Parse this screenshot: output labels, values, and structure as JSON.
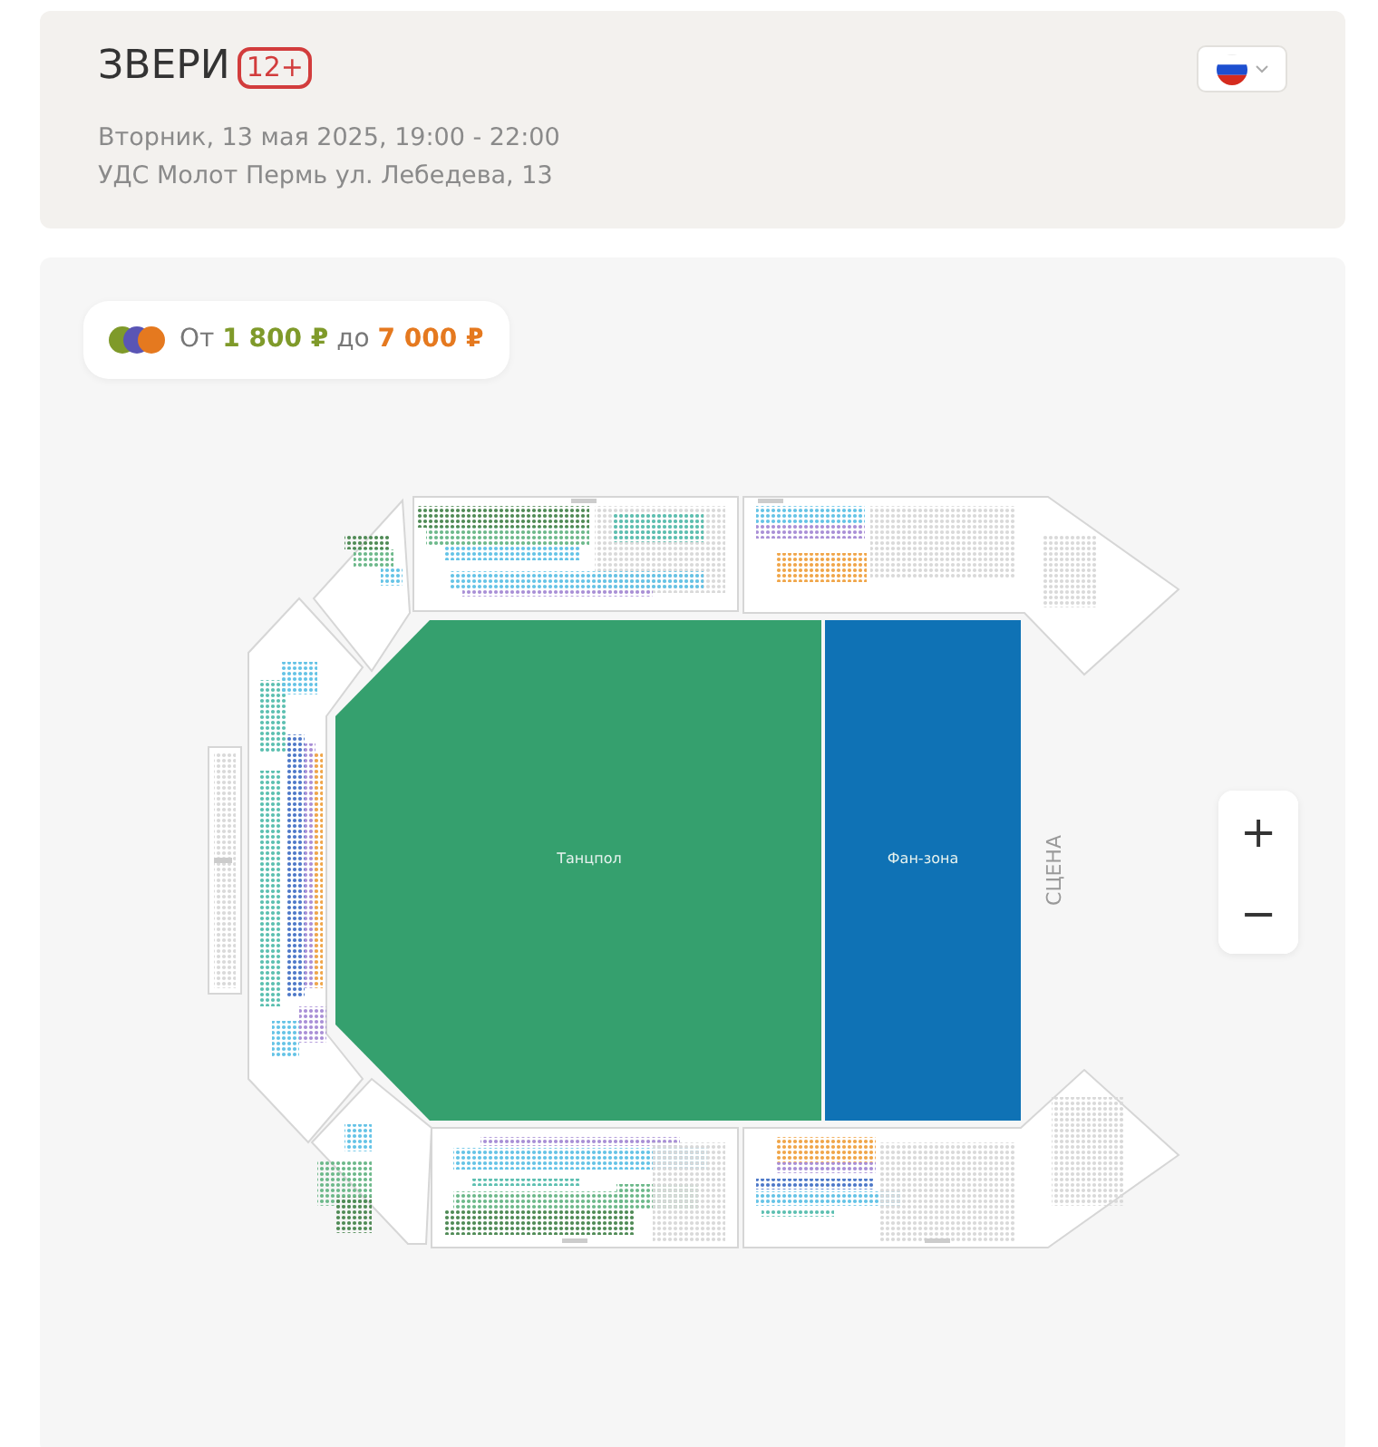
{
  "event": {
    "title": "ЗВЕРИ",
    "age_badge": "12+",
    "datetime": "Вторник, 13 мая 2025, 19:00 - 22:00",
    "venue": "УДС Молот Пермь ул. Лебедева, 13"
  },
  "price_range": {
    "legend_dots": [
      {
        "color": "#7f9a2a"
      },
      {
        "color": "#5a55b5"
      },
      {
        "color": "#e5791f"
      }
    ],
    "from_label": "От",
    "min_price": "1 800 ₽",
    "to_label": "до",
    "max_price": "7 000 ₽"
  },
  "map": {
    "zones": [
      {
        "kind": "dancefloor",
        "label": "Танцпол",
        "color": "#35a06e"
      },
      {
        "kind": "fanzone",
        "label": "Фан-зона",
        "color": "#0f72b5"
      }
    ],
    "stage_label": "СЦЕНА",
    "zoom_controls": [
      "+",
      "−"
    ]
  }
}
